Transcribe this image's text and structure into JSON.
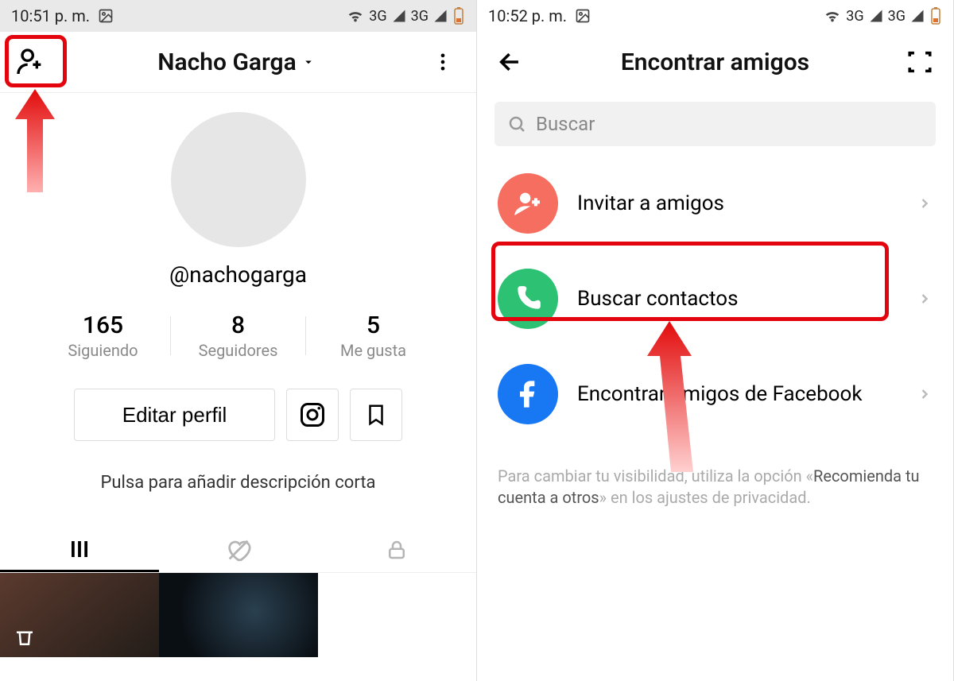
{
  "left": {
    "status": {
      "time": "10:51 p. m.",
      "network": "3G"
    },
    "header": {
      "title": "Nacho Garga"
    },
    "profile": {
      "username": "@nachogarga",
      "stats": {
        "following_num": "165",
        "following_lbl": "Siguiendo",
        "followers_num": "8",
        "followers_lbl": "Seguidores",
        "likes_num": "5",
        "likes_lbl": "Me gusta"
      },
      "edit_btn": "Editar perfil",
      "bio_prompt": "Pulsa para añadir descripción corta"
    }
  },
  "right": {
    "status": {
      "time": "10:52 p. m.",
      "network": "3G"
    },
    "header": {
      "title": "Encontrar amigos"
    },
    "search_placeholder": "Buscar",
    "options": {
      "invite": "Invitar a amigos",
      "contacts": "Buscar contactos",
      "facebook": "Encontrar amigos de Facebook"
    },
    "footer": {
      "pre": "Para cambiar tu visibilidad, utiliza la opción «",
      "em": "Recomienda tu cuenta a otros",
      "post": "» en los ajustes de privacidad."
    }
  }
}
